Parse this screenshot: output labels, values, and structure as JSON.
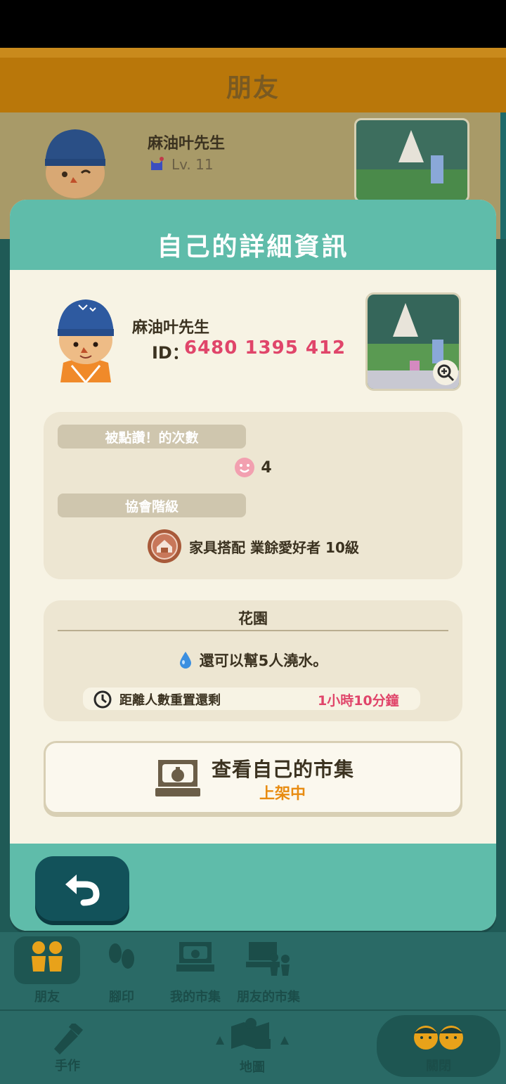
{
  "background": {
    "header_title": "朋友",
    "friend_name": "麻油叶先生",
    "friend_level": "Lv. 11"
  },
  "modal": {
    "title": "自己的詳細資訊",
    "name": "麻油叶先生",
    "id_label": "ID：",
    "id_value": "6480 1395 412",
    "likes_label": "被點讚！的次數",
    "likes_count": "4",
    "rank_label": "協會階級",
    "rank_value": "家具搭配 業餘愛好者 10級",
    "garden_title": "花園",
    "water_text": "還可以幫5人澆水。",
    "reset_label": "距離人數重置還剩",
    "reset_time": "1小時10分鐘",
    "market_label": "查看自己的市集",
    "market_status": "上架中"
  },
  "nav": {
    "row1": [
      {
        "label": "朋友",
        "icon": "friends-icon"
      },
      {
        "label": "腳印",
        "icon": "footprint-icon"
      },
      {
        "label": "我的市集",
        "icon": "market-icon"
      },
      {
        "label": "朋友的市集",
        "icon": "friends-market-icon"
      }
    ],
    "row2": [
      {
        "label": "手作",
        "icon": "craft-icon"
      },
      {
        "label": "地圖",
        "icon": "map-icon"
      },
      {
        "label": "關閉",
        "icon": "close-icon"
      }
    ]
  },
  "colors": {
    "teal": "#5fbcaa",
    "dark_teal": "#12525a",
    "accent_pink": "#e0456a",
    "accent_orange": "#e88c12",
    "header_brown": "#b9770a"
  }
}
